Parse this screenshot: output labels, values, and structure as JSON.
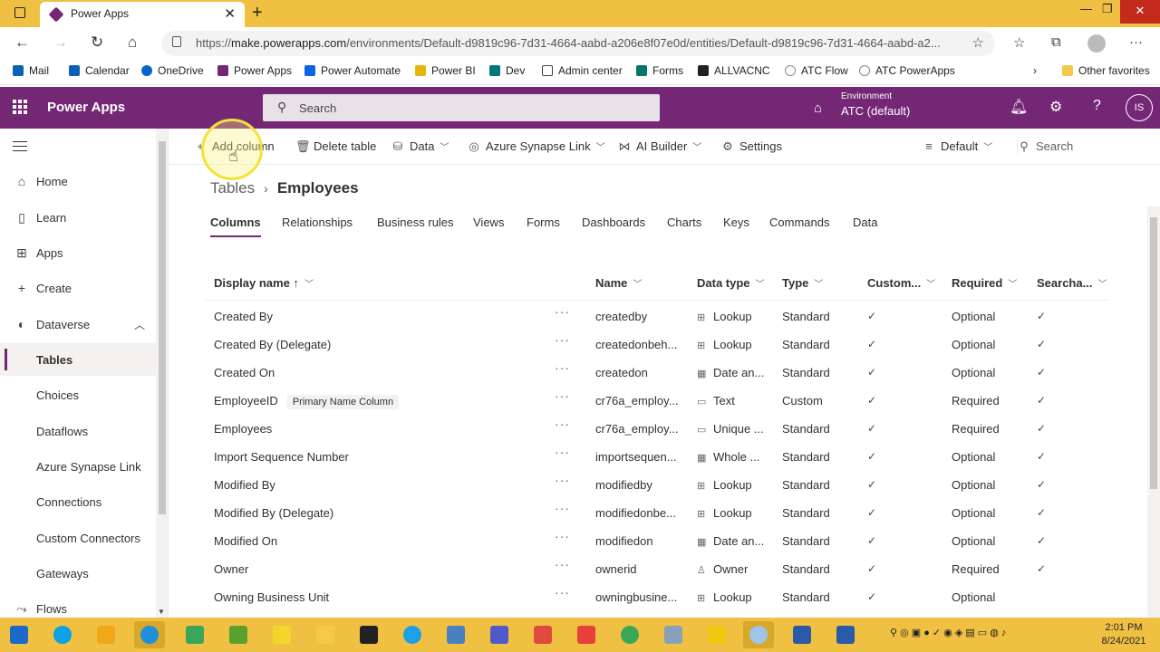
{
  "browser": {
    "tab_title": "Power Apps",
    "url_prefix": "https://",
    "url_host": "make.powerapps.com",
    "url_path": "/environments/Default-d9819c96-7d31-4664-aabd-a206e8f07e0d/entities/Default-d9819c96-7d31-4664-aabd-a2..."
  },
  "favorites": {
    "items": [
      "Mail",
      "Calendar",
      "OneDrive",
      "Power Apps",
      "Power Automate",
      "Power BI",
      "Dev",
      "Admin center",
      "Forms",
      "ALLVACNC",
      "ATC Flow",
      "ATC PowerApps"
    ],
    "other": "Other favorites"
  },
  "header": {
    "app_name": "Power Apps",
    "search_placeholder": "Search",
    "env_label": "Environment",
    "env_value": "ATC (default)",
    "user_initials": "IS"
  },
  "nav": {
    "items": [
      {
        "label": "Home",
        "icon": "home-icon"
      },
      {
        "label": "Learn",
        "icon": "book-icon"
      },
      {
        "label": "Apps",
        "icon": "apps-icon"
      },
      {
        "label": "Create",
        "icon": "plus-icon"
      },
      {
        "label": "Dataverse",
        "icon": "dataverse-icon"
      },
      {
        "label": "Tables"
      },
      {
        "label": "Choices"
      },
      {
        "label": "Dataflows"
      },
      {
        "label": "Azure Synapse Link"
      },
      {
        "label": "Connections"
      },
      {
        "label": "Custom Connectors"
      },
      {
        "label": "Gateways"
      },
      {
        "label": "Flows",
        "icon": "flows-icon"
      }
    ]
  },
  "commands": {
    "add_column": "Add column",
    "delete_table": "Delete table",
    "data": "Data",
    "synapse": "Azure Synapse Link",
    "ai_builder": "AI Builder",
    "settings": "Settings",
    "view": "Default",
    "search": "Search"
  },
  "breadcrumb": {
    "parent": "Tables",
    "current": "Employees"
  },
  "subtabs": [
    "Columns",
    "Relationships",
    "Business rules",
    "Views",
    "Forms",
    "Dashboards",
    "Charts",
    "Keys",
    "Commands",
    "Data"
  ],
  "table": {
    "headers": [
      "Display name ↑",
      "Name",
      "Data type",
      "Type",
      "Custom...",
      "Required",
      "Searcha..."
    ],
    "rows": [
      {
        "display": "Created By",
        "badge": "",
        "name": "createdby",
        "dtype": "Lookup",
        "type": "Standard",
        "custom": "✓",
        "required": "Optional",
        "search": "✓"
      },
      {
        "display": "Created By (Delegate)",
        "badge": "",
        "name": "createdonbeh...",
        "dtype": "Lookup",
        "type": "Standard",
        "custom": "✓",
        "required": "Optional",
        "search": "✓"
      },
      {
        "display": "Created On",
        "badge": "",
        "name": "createdon",
        "dtype": "Date an...",
        "type": "Standard",
        "custom": "✓",
        "required": "Optional",
        "search": "✓"
      },
      {
        "display": "EmployeeID",
        "badge": "Primary Name Column",
        "name": "cr76a_employ...",
        "dtype": "Text",
        "type": "Custom",
        "custom": "✓",
        "required": "Required",
        "search": "✓"
      },
      {
        "display": "Employees",
        "badge": "",
        "name": "cr76a_employ...",
        "dtype": "Unique ...",
        "type": "Standard",
        "custom": "✓",
        "required": "Required",
        "search": "✓"
      },
      {
        "display": "Import Sequence Number",
        "badge": "",
        "name": "importsequen...",
        "dtype": "Whole ...",
        "type": "Standard",
        "custom": "✓",
        "required": "Optional",
        "search": "✓"
      },
      {
        "display": "Modified By",
        "badge": "",
        "name": "modifiedby",
        "dtype": "Lookup",
        "type": "Standard",
        "custom": "✓",
        "required": "Optional",
        "search": "✓"
      },
      {
        "display": "Modified By (Delegate)",
        "badge": "",
        "name": "modifiedonbe...",
        "dtype": "Lookup",
        "type": "Standard",
        "custom": "✓",
        "required": "Optional",
        "search": "✓"
      },
      {
        "display": "Modified On",
        "badge": "",
        "name": "modifiedon",
        "dtype": "Date an...",
        "type": "Standard",
        "custom": "✓",
        "required": "Optional",
        "search": "✓"
      },
      {
        "display": "Owner",
        "badge": "",
        "name": "ownerid",
        "dtype": "Owner",
        "type": "Standard",
        "custom": "✓",
        "required": "Required",
        "search": "✓"
      },
      {
        "display": "Owning Business Unit",
        "badge": "",
        "name": "owningbusine...",
        "dtype": "Lookup",
        "type": "Standard",
        "custom": "✓",
        "required": "Optional",
        "search": ""
      }
    ]
  },
  "taskbar": {
    "time": "2:01 PM",
    "date": "8/24/2021"
  },
  "colors": {
    "brand": "#742774",
    "taskbar": "#f0c043"
  }
}
